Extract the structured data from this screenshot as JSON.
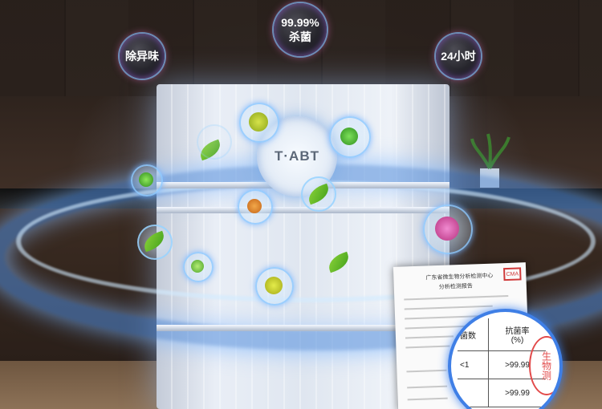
{
  "bubbles": {
    "deodorize": "除异味",
    "sterilize_pct": "99.99%",
    "sterilize_label": "杀菌",
    "hours": "24小时"
  },
  "fridge": {
    "tech_label": "T·ABT"
  },
  "certificate": {
    "header": "广东省微生物分析检测中心",
    "subheader": "分析检测报告",
    "col_label": "抗菌率",
    "col_unit": "(%)",
    "row1_prefix": "<1",
    "row1_value": ">99.99",
    "row2_value": ">99.99",
    "stamp": "生物测",
    "badge": "CMA",
    "partial_header": "菌数"
  },
  "colors": {
    "accent_blue": "#3f7fe6",
    "leaf_green": "#6cc02a",
    "stamp_red": "#e24a4a"
  }
}
